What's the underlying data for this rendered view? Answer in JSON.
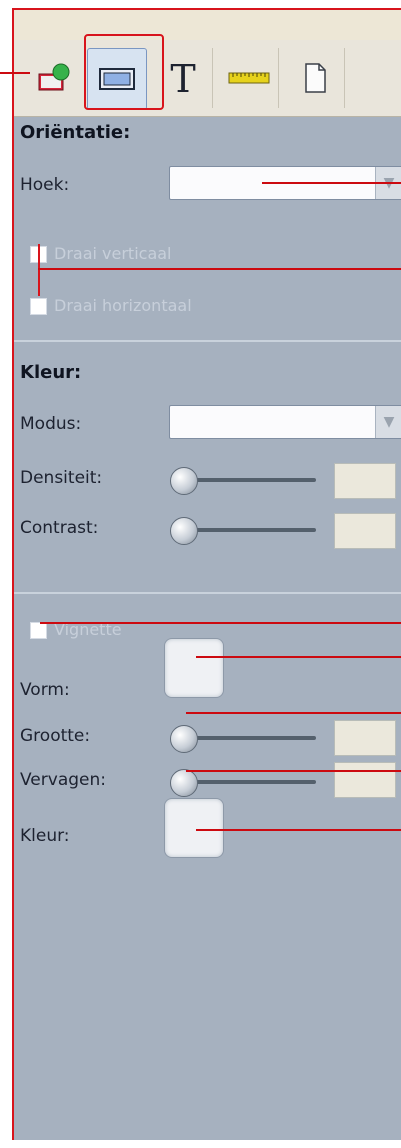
{
  "orientation": {
    "heading": "Oriëntatie:",
    "angle_label": "Hoek:",
    "angle_value": "",
    "flip_vertical_label": "Draai verticaal",
    "flip_horizontal_label": "Draai horizontaal"
  },
  "color": {
    "heading": "Kleur:",
    "mode_label": "Modus:",
    "mode_value": "",
    "density_label": "Densiteit:",
    "density_value": "",
    "contrast_label": "Contrast:",
    "contrast_value": ""
  },
  "vignette": {
    "enable_label": "Vignette",
    "shape_label": "Vorm:",
    "size_label": "Grootte:",
    "size_value": "",
    "fade_label": "Vervagen:",
    "fade_value": "",
    "color_label": "Kleur:"
  },
  "toolbar": {
    "icons": [
      "image-paint-icon",
      "rectangle-icon",
      "text-icon",
      "ruler-icon",
      "page-icon"
    ]
  },
  "colors": {
    "panel_bg": "#a6b1bf",
    "annotation_red": "#d8141c",
    "toolbar_bg": "#e9e5db"
  }
}
